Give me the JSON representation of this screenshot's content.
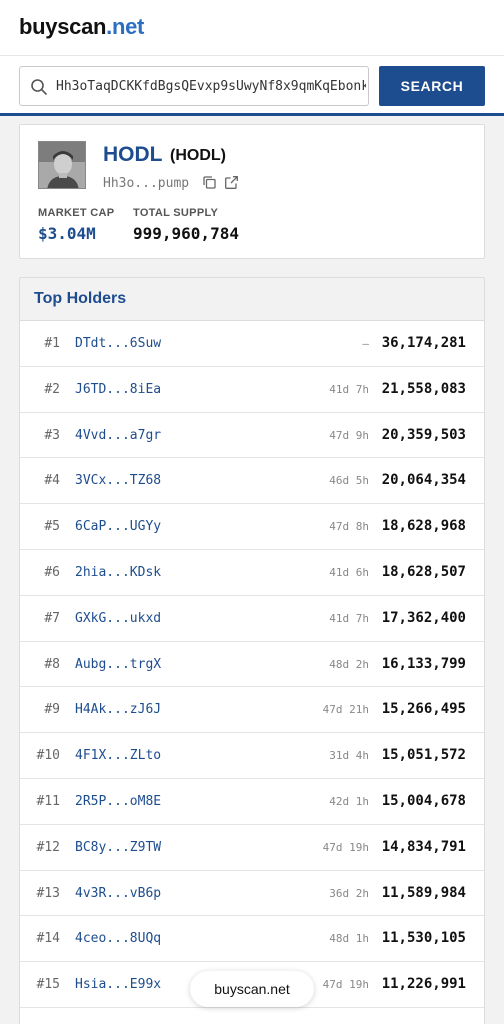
{
  "header": {
    "logo_part1": "buyscan",
    "logo_part2": ".net"
  },
  "search": {
    "value": "Hh3oTaqDCKKfdBgsQEvxp9sUwyNf8x9qmKqEbonk",
    "button_label": "SEARCH"
  },
  "token": {
    "name": "HODL",
    "symbol": "(HODL)",
    "address_short": "Hh3o...pump",
    "market_cap_label": "MARKET CAP",
    "market_cap": "$3.04M",
    "total_supply_label": "TOTAL SUPPLY",
    "total_supply": "999,960,784"
  },
  "holders": {
    "title": "Top Holders",
    "rows": [
      {
        "rank": "#1",
        "address": "DTdt...6Suw",
        "age": "–",
        "amount": "36,174,281"
      },
      {
        "rank": "#2",
        "address": "J6TD...8iEa",
        "age": "41d 7h",
        "amount": "21,558,083"
      },
      {
        "rank": "#3",
        "address": "4Vvd...a7gr",
        "age": "47d 9h",
        "amount": "20,359,503"
      },
      {
        "rank": "#4",
        "address": "3VCx...TZ68",
        "age": "46d 5h",
        "amount": "20,064,354"
      },
      {
        "rank": "#5",
        "address": "6CaP...UGYy",
        "age": "47d 8h",
        "amount": "18,628,968"
      },
      {
        "rank": "#6",
        "address": "2hia...KDsk",
        "age": "41d 6h",
        "amount": "18,628,507"
      },
      {
        "rank": "#7",
        "address": "GXkG...ukxd",
        "age": "41d 7h",
        "amount": "17,362,400"
      },
      {
        "rank": "#8",
        "address": "Aubg...trgX",
        "age": "48d 2h",
        "amount": "16,133,799"
      },
      {
        "rank": "#9",
        "address": "H4Ak...zJ6J",
        "age": "47d 21h",
        "amount": "15,266,495"
      },
      {
        "rank": "#10",
        "address": "4F1X...ZLto",
        "age": "31d 4h",
        "amount": "15,051,572"
      },
      {
        "rank": "#11",
        "address": "2R5P...oM8E",
        "age": "42d 1h",
        "amount": "15,004,678"
      },
      {
        "rank": "#12",
        "address": "BC8y...Z9TW",
        "age": "47d 19h",
        "amount": "14,834,791"
      },
      {
        "rank": "#13",
        "address": "4v3R...vB6p",
        "age": "36d 2h",
        "amount": "11,589,984"
      },
      {
        "rank": "#14",
        "address": "4ceo...8UQq",
        "age": "48d 1h",
        "amount": "11,530,105"
      },
      {
        "rank": "#15",
        "address": "Hsia...E99x",
        "age": "47d 19h",
        "amount": "11,226,991"
      }
    ]
  },
  "footer": {
    "pill_label": "buyscan.net"
  },
  "colors": {
    "accent": "#1e4d8f",
    "logo_blue": "#2c6fc1"
  }
}
